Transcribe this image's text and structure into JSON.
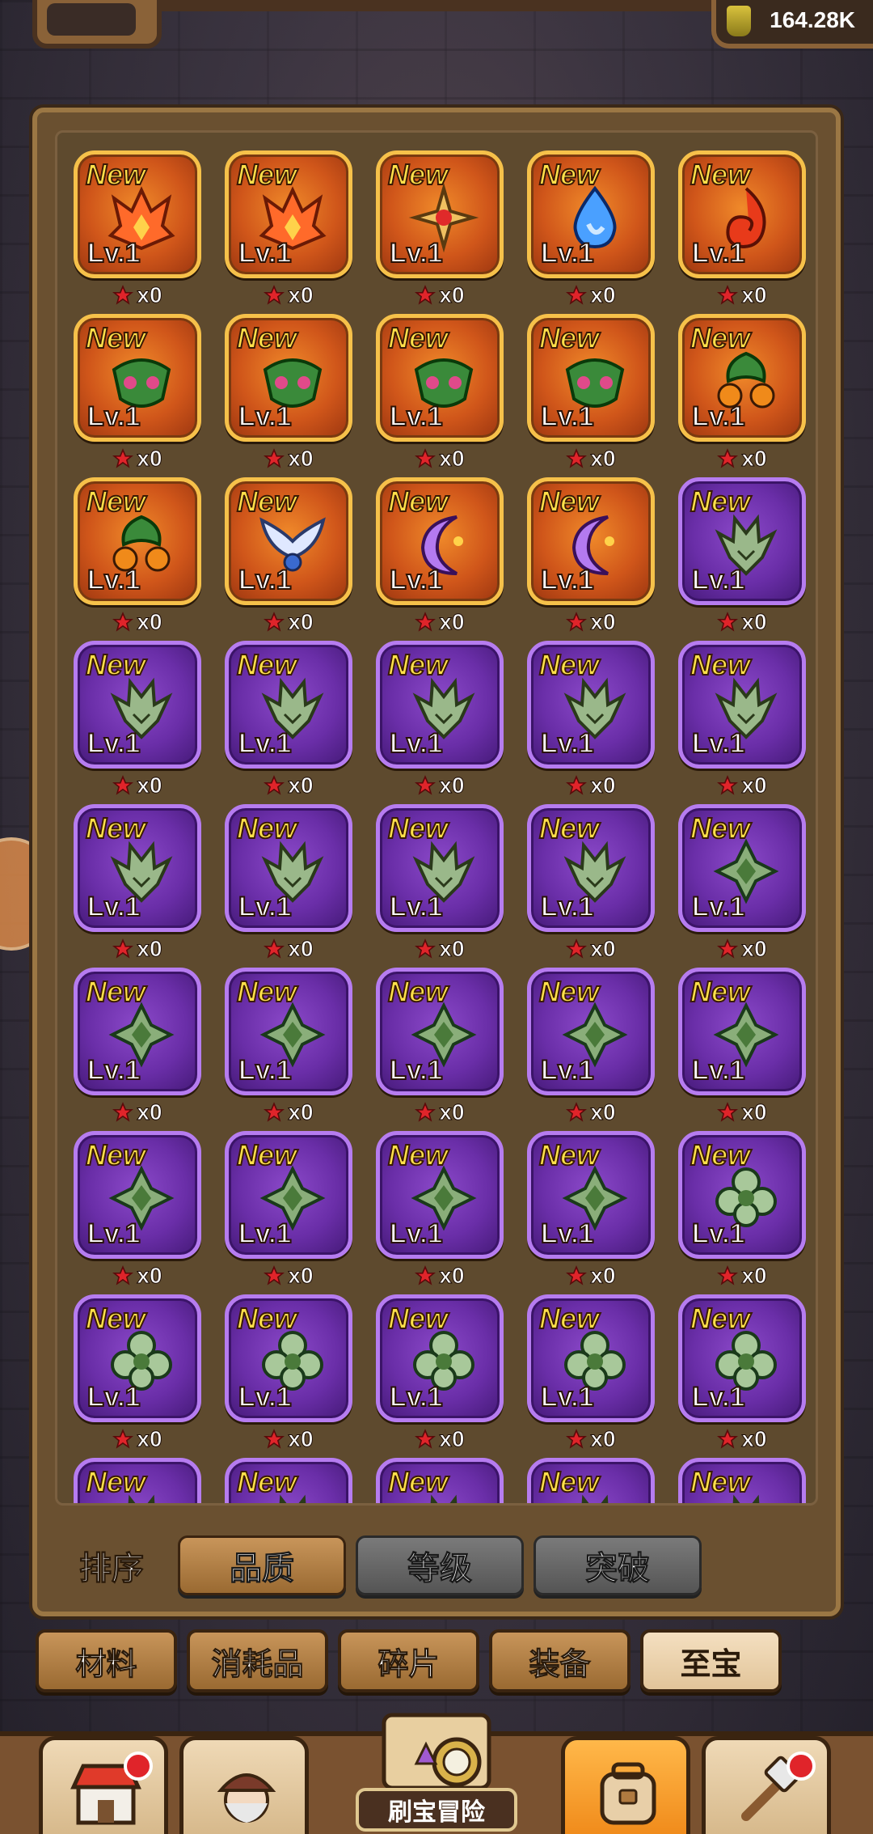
{
  "top": {
    "currency_amount": "164.28K"
  },
  "colors": {
    "panel": "#6a5030",
    "orange_card": "#d0561a",
    "purple_card": "#6a2ea8",
    "active_button": "#b58048",
    "inactive_button": "#666666"
  },
  "grid": {
    "new_label": "New",
    "level_label": "Lv.1",
    "count_label": "x0",
    "items": [
      {
        "rarity": "orange",
        "icon": "fire-crown-icon"
      },
      {
        "rarity": "orange",
        "icon": "fire-crown-icon"
      },
      {
        "rarity": "orange",
        "icon": "golden-cross-icon"
      },
      {
        "rarity": "orange",
        "icon": "water-drop-icon"
      },
      {
        "rarity": "orange",
        "icon": "fire-swirl-icon"
      },
      {
        "rarity": "orange",
        "icon": "green-mask-icon"
      },
      {
        "rarity": "orange",
        "icon": "green-mask-icon"
      },
      {
        "rarity": "orange",
        "icon": "green-mask-icon"
      },
      {
        "rarity": "orange",
        "icon": "green-mask-icon"
      },
      {
        "rarity": "orange",
        "icon": "green-fruit-icon"
      },
      {
        "rarity": "orange",
        "icon": "green-fruit-icon"
      },
      {
        "rarity": "orange",
        "icon": "winged-emblem-icon"
      },
      {
        "rarity": "orange",
        "icon": "crescent-moon-icon"
      },
      {
        "rarity": "orange",
        "icon": "crescent-moon-icon"
      },
      {
        "rarity": "purple",
        "icon": "green-dragon-icon"
      },
      {
        "rarity": "purple",
        "icon": "green-dragon-icon"
      },
      {
        "rarity": "purple",
        "icon": "green-dragon-icon"
      },
      {
        "rarity": "purple",
        "icon": "green-dragon-icon"
      },
      {
        "rarity": "purple",
        "icon": "green-dragon-icon"
      },
      {
        "rarity": "purple",
        "icon": "green-dragon-icon"
      },
      {
        "rarity": "purple",
        "icon": "green-dragon-icon"
      },
      {
        "rarity": "purple",
        "icon": "green-dragon-icon"
      },
      {
        "rarity": "purple",
        "icon": "green-dragon-icon"
      },
      {
        "rarity": "purple",
        "icon": "green-dragon-icon"
      },
      {
        "rarity": "purple",
        "icon": "green-shield-cross-icon"
      },
      {
        "rarity": "purple",
        "icon": "green-shield-cross-icon"
      },
      {
        "rarity": "purple",
        "icon": "green-shield-cross-icon"
      },
      {
        "rarity": "purple",
        "icon": "green-shield-cross-icon"
      },
      {
        "rarity": "purple",
        "icon": "green-shield-cross-icon"
      },
      {
        "rarity": "purple",
        "icon": "green-shield-cross-icon"
      },
      {
        "rarity": "purple",
        "icon": "green-shield-cross-icon"
      },
      {
        "rarity": "purple",
        "icon": "green-shield-cross-icon"
      },
      {
        "rarity": "purple",
        "icon": "green-shield-cross-icon"
      },
      {
        "rarity": "purple",
        "icon": "green-shield-cross-icon"
      },
      {
        "rarity": "purple",
        "icon": "green-clover-icon"
      },
      {
        "rarity": "purple",
        "icon": "green-clover-icon"
      },
      {
        "rarity": "purple",
        "icon": "green-clover-icon"
      },
      {
        "rarity": "purple",
        "icon": "green-clover-icon"
      },
      {
        "rarity": "purple",
        "icon": "green-clover-icon"
      },
      {
        "rarity": "purple",
        "icon": "green-clover-icon"
      },
      {
        "rarity": "purple",
        "icon": "green-dragon-icon"
      },
      {
        "rarity": "purple",
        "icon": "green-dragon-icon"
      },
      {
        "rarity": "purple",
        "icon": "green-dragon-icon"
      },
      {
        "rarity": "purple",
        "icon": "green-dragon-icon"
      },
      {
        "rarity": "purple",
        "icon": "green-dragon-icon"
      }
    ]
  },
  "sort": {
    "label": "排序",
    "buttons": [
      {
        "label": "品质",
        "active": true
      },
      {
        "label": "等级",
        "active": false
      },
      {
        "label": "突破",
        "active": false
      }
    ]
  },
  "categories": [
    {
      "label": "材料",
      "active": false
    },
    {
      "label": "消耗品",
      "active": false
    },
    {
      "label": "碎片",
      "active": false
    },
    {
      "label": "装备",
      "active": false
    },
    {
      "label": "至宝",
      "active": true
    }
  ],
  "bottom_nav": {
    "center_label": "刷宝冒险",
    "items": [
      {
        "icon": "shop-icon",
        "badge": true,
        "active": false
      },
      {
        "icon": "hero-icon",
        "badge": false,
        "active": false
      },
      {
        "icon": "backpack-icon",
        "badge": false,
        "active": true
      },
      {
        "icon": "forge-hammer-icon",
        "badge": true,
        "active": false
      }
    ]
  }
}
